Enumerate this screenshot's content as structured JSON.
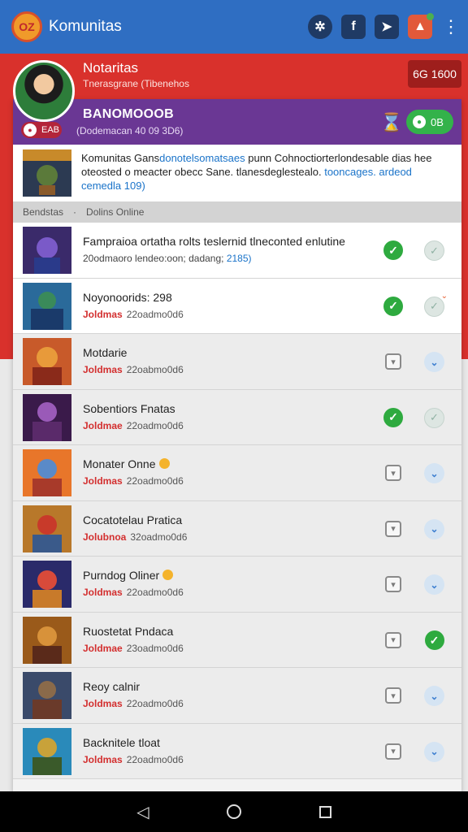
{
  "app": {
    "title": "Komunitas",
    "logo_text": "OZ"
  },
  "toolbar": {
    "buttons": [
      {
        "icon": "close-star-icon",
        "glyph": "✲"
      },
      {
        "icon": "facebook-icon",
        "glyph": "f"
      },
      {
        "icon": "share-icon",
        "glyph": "➤"
      },
      {
        "icon": "notification-icon",
        "glyph": "▲"
      }
    ],
    "more_glyph": "⋮"
  },
  "profile": {
    "name": "Notaritas",
    "subtitle": "Tnerasgrane (Tibenehos",
    "badge": "6G 1600"
  },
  "banner": {
    "title": "BANOMOOOB",
    "subtitle": "(Dodemacan  40 09 3D6)",
    "pill_text": "EAB",
    "hourglass": "⌛",
    "status_count": "0B"
  },
  "description": {
    "text_a": "Komunitas Gans",
    "link_a": "donotelsomatsaes",
    "text_b": " punn Cohnoctiorterlondesable dias hee oteosted o meacter obecc Sane. tlanesdeglestealo. ",
    "link_b": "tooncages. ardeod cemedla 109)"
  },
  "section": {
    "left": "Bendstas",
    "right": "Dolins Online"
  },
  "rows": [
    {
      "title": "Fampraioa ortatha rolts teslernid tlneconted enlutine",
      "sub_plain": "20odmaoro lendeo:oon; dadang; ",
      "sub_link": "2185)",
      "tone": "a",
      "c1": "check-green",
      "c2": "check-pale"
    },
    {
      "title": "Noyonoorids: 298",
      "sub_hl": "Joldmas",
      "sub_rest": "22oadmo0d6",
      "tone": "b",
      "c1": "check-green",
      "c2": "check-pale-badge"
    },
    {
      "title": "Motdarie",
      "sub_hl": "Joldmas",
      "sub_rest": "22oabmo0d6",
      "tone": "c",
      "c1": "square-chevron",
      "c2": "circle-blue"
    },
    {
      "title": "Sobentiors Fnatas",
      "sub_hl": "Joldmae",
      "sub_rest": "22oadmo0d6",
      "tone": "d",
      "c1": "check-green",
      "c2": "check-pale"
    },
    {
      "title": "Monater Onne",
      "emoji": true,
      "sub_hl": "Joldmas",
      "sub_rest": "22oadmo0d6",
      "tone": "e",
      "c1": "square-chevron",
      "c2": "circle-blue"
    },
    {
      "title": "Cocatotelau Pratica",
      "sub_hl": "Jolubnoa",
      "sub_rest": "32oadmo0d6",
      "tone": "f",
      "c1": "square-chevron",
      "c2": "circle-blue"
    },
    {
      "title": "Purndog Oliner",
      "emoji": true,
      "sub_hl": "Joldmas",
      "sub_rest": "22oadmo0d6",
      "tone": "g",
      "c1": "square-chevron",
      "c2": "circle-blue"
    },
    {
      "title": "Ruostetat Pndaca",
      "sub_hl": "Joldmae",
      "sub_rest": "23oadmo0d6",
      "tone": "h",
      "c1": "square-chevron",
      "c2": "check-green"
    },
    {
      "title": "Reoy calnir",
      "sub_hl": "Joldmas",
      "sub_rest": "22oadmo0d6",
      "tone": "i",
      "c1": "square-chevron",
      "c2": "circle-blue"
    },
    {
      "title": "Backnitele tloat",
      "sub_hl": "Joldmas",
      "sub_rest": "22oadmo0d6",
      "tone": "j",
      "c1": "square-chevron",
      "c2": "circle-blue"
    }
  ],
  "nav": {
    "back": "◁"
  },
  "colors": {
    "appbar": "#2f6ec2",
    "red_band": "#d9312c",
    "purple": "#6a3794",
    "green": "#2eaa3f"
  }
}
